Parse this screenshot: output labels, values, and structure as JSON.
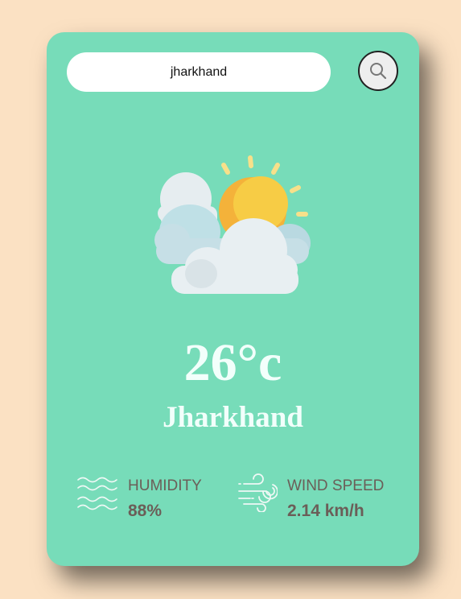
{
  "search": {
    "value": "jharkhand",
    "button_icon": "search-icon"
  },
  "weather": {
    "icon": "partly-cloudy-icon",
    "temperature": "26°c",
    "city": "Jharkhand"
  },
  "details": {
    "humidity": {
      "icon": "humidity-waves-icon",
      "label": "HUMIDITY",
      "value": "88%"
    },
    "wind": {
      "icon": "wind-icon",
      "label": "WIND SPEED",
      "value": "2.14 km/h"
    }
  },
  "colors": {
    "page_background": "#fbe1c3",
    "card_background": "#77dcb9",
    "text_light": "#f2fffb",
    "text_dark": "#6b5e58"
  }
}
